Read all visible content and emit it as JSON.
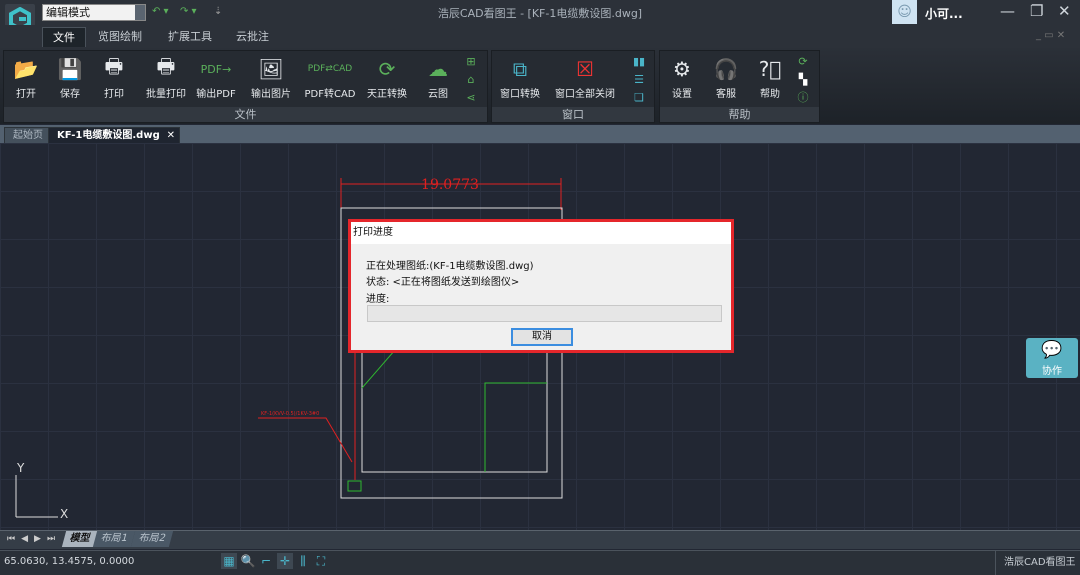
{
  "titlebar": {
    "mode": "编辑模式",
    "title": "浩辰CAD看图王 - [KF-1电缆敷设图.dwg]",
    "user": "小可..."
  },
  "menu_tabs": [
    "文件",
    "览图绘制",
    "扩展工具",
    "云批注"
  ],
  "ribbon": {
    "file_group": {
      "label": "文件",
      "buttons": [
        "打开",
        "保存",
        "打印",
        "批量打印",
        "输出PDF",
        "输出图片",
        "PDF转CAD",
        "天正转换",
        "云图"
      ]
    },
    "window_group": {
      "label": "窗口",
      "buttons": [
        "窗口转换",
        "窗口全部关闭"
      ]
    },
    "help_group": {
      "label": "帮助",
      "buttons": [
        "设置",
        "客服",
        "帮助"
      ]
    }
  },
  "doc_tabs": [
    "起始页",
    "KF-1电缆敷设图.dwg"
  ],
  "drawing": {
    "dimension": "19.0773",
    "annotation": "KF-1(KVV-0.5)/1KV-3#0",
    "ucs_x": "X",
    "ucs_y": "Y"
  },
  "dialog": {
    "title": "打印进度",
    "file_line": "正在处理图纸:(KF-1电缆敷设图.dwg)",
    "status_line": "状态: <正在将图纸发送到绘图仪>",
    "progress_label": "进度:",
    "progress": 0,
    "cancel": "取消"
  },
  "collab": "协作",
  "layout_tabs": [
    "模型",
    "布局1",
    "布局2"
  ],
  "status": {
    "coords": "65.0630, 13.4575, 0.0000",
    "brand": "浩辰CAD看图王"
  }
}
